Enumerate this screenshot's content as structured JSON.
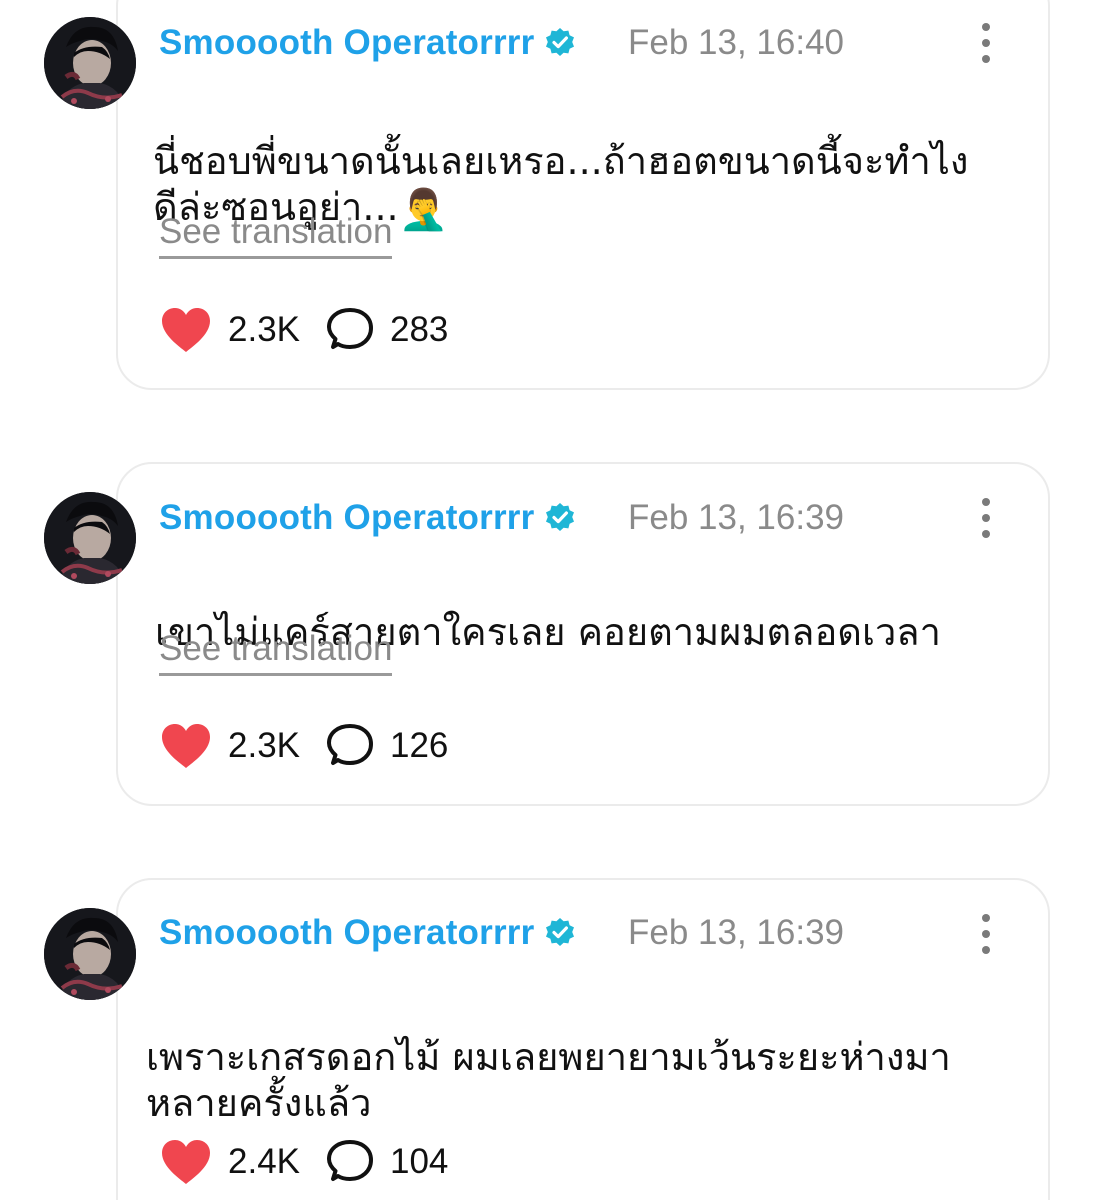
{
  "posts": [
    {
      "author": "Smooooth Operatorrrr",
      "verified": true,
      "timestamp": "Feb 13, 16:40",
      "text": "นี่ชอบพี่ขนาดนั้นเลยเหรอ...ถ้าฮอตขนาดนี้จะทำไง\nดีล่ะซอนอูย่า...",
      "emoji": "🤦‍♂️",
      "translate_label": "See translation",
      "likes": "2.3K",
      "comments": "283"
    },
    {
      "author": "Smooooth Operatorrrr",
      "verified": true,
      "timestamp": "Feb 13, 16:39",
      "text": "เขาไม่แคร์สายตาใครเลย  คอยตามผมตลอดเวลา",
      "translate_label": "See translation",
      "likes": "2.3K",
      "comments": "126"
    },
    {
      "author": "Smooooth Operatorrrr",
      "verified": true,
      "timestamp": "Feb 13, 16:39",
      "text": "เพราะเกสรดอกไม้  ผมเลยพยายามเว้นระยะห่างมา\nหลายครั้งแล้ว",
      "likes": "2.4K",
      "comments": "104"
    }
  ],
  "colors": {
    "author": "#1fa1e8",
    "verified_badge": "#1fb6d6",
    "like_heart": "#f0464f",
    "muted_text": "#8a8a8a",
    "card_border": "#ebebeb"
  },
  "icons": {
    "verified": "verified-badge-icon",
    "like": "heart-icon",
    "comment": "speech-bubble-icon",
    "more": "more-vertical-icon"
  }
}
